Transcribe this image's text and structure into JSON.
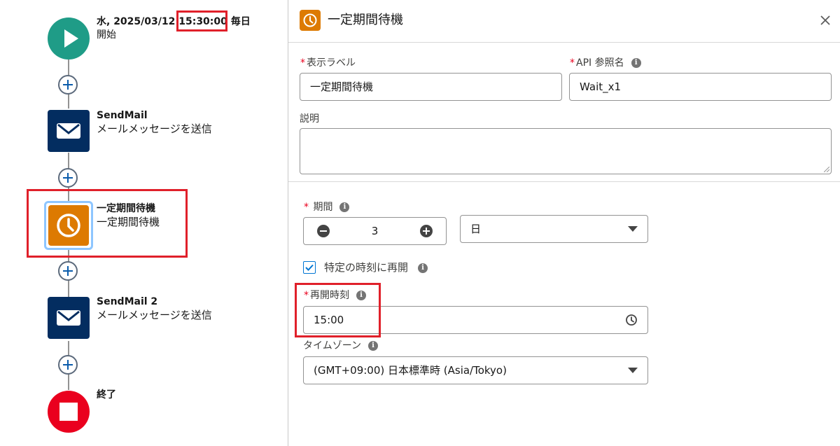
{
  "flow": {
    "start": {
      "icon": "play-icon",
      "title_prefix": "水, 2025/03/12 ",
      "title_time": "15:30:00",
      "title_suffix": " 毎日",
      "subtitle": "開始",
      "color": "#1f9c87"
    },
    "nodes": [
      {
        "title": "SendMail",
        "subtitle": "メールメッセージを送信",
        "icon": "envelope-icon",
        "color": "#032d60"
      },
      {
        "title": "一定期間待機",
        "subtitle": "一定期間待機",
        "icon": "clock-icon",
        "color": "#dd7a01",
        "selected": true
      },
      {
        "title": "SendMail 2",
        "subtitle": "メールメッセージを送信",
        "icon": "envelope-icon",
        "color": "#032d60"
      }
    ],
    "end": {
      "icon": "stop-icon",
      "title": "終了",
      "color": "#ea001e"
    }
  },
  "panel": {
    "header": {
      "title": "一定期間待機",
      "icon": "clock-icon",
      "close_icon": "close-icon"
    },
    "label_field": {
      "required": "*",
      "label": "表示ラベル",
      "value": "一定期間待機"
    },
    "api_field": {
      "required": "*",
      "label": "API 参照名",
      "value": "Wait_x1",
      "info": "i"
    },
    "description_field": {
      "label": "説明",
      "value": ""
    },
    "duration": {
      "required": "*",
      "label": "期間",
      "info": "i",
      "value": "3",
      "unit_options": [
        "日"
      ],
      "unit_selected": "日"
    },
    "specific_time": {
      "checked": true,
      "label": "特定の時刻に再開",
      "info": "i"
    },
    "resume_time": {
      "required": "*",
      "label": "再開時刻",
      "info": "i",
      "value": "15:00"
    },
    "timezone": {
      "label": "タイムゾーン",
      "info": "i",
      "value": "(GMT+09:00) 日本標準時 (Asia/Tokyo)"
    }
  },
  "colors": {
    "highlight": "#e0202a",
    "accent_blue": "#0176d3"
  }
}
